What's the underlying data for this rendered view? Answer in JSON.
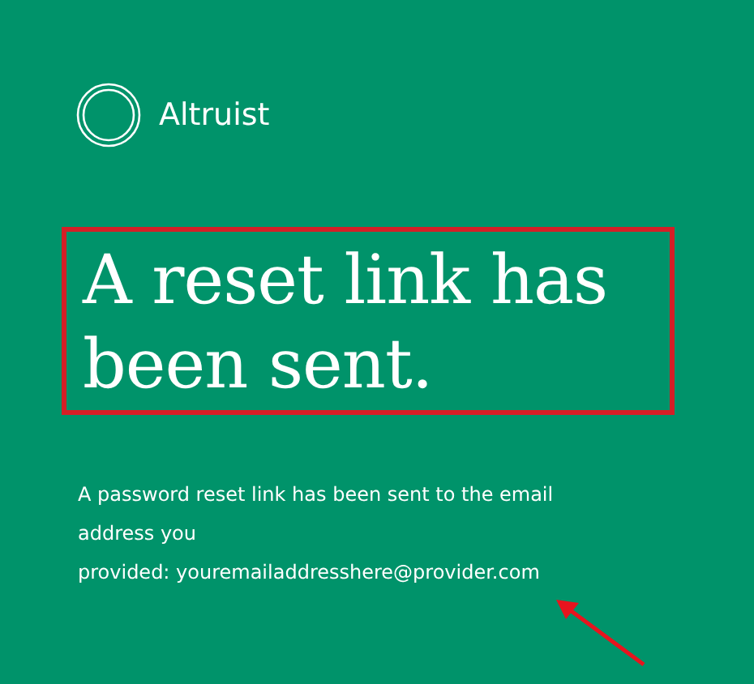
{
  "logo": {
    "name": "Altruist"
  },
  "heading": "A reset link has been sent.",
  "message_lines": [
    "A password reset link has been sent to the email",
    "address you",
    "provided: youremailaddresshere@provider.com"
  ]
}
